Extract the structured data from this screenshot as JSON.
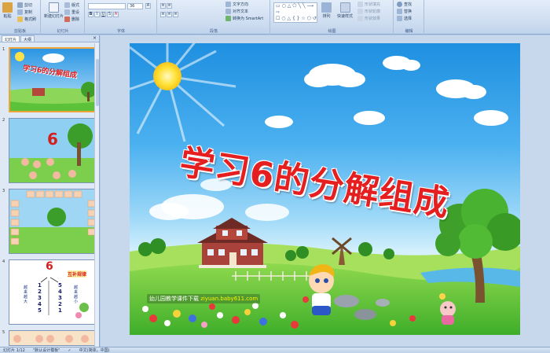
{
  "ribbon": {
    "clipboard": {
      "label": "剪贴板",
      "paste": "粘贴",
      "cut": "剪切",
      "copy": "复制",
      "format": "格式刷"
    },
    "slides": {
      "label": "幻灯片",
      "new_slide": "新建幻灯片",
      "layout": "版式",
      "reset": "重设",
      "delete": "删除"
    },
    "font": {
      "label": "字体",
      "font_name": "",
      "font_size": "36"
    },
    "paragraph": {
      "label": "段落",
      "text_direction": "文字方向",
      "align_text": "对齐文本",
      "smartart": "转换为 SmartArt"
    },
    "drawing": {
      "label": "绘图",
      "arrange": "排列",
      "quick_styles": "快速样式",
      "shape_fill": "形状填充",
      "shape_outline": "形状轮廓",
      "shape_effects": "形状效果"
    },
    "editing": {
      "label": "编辑",
      "find": "查找",
      "replace": "替换",
      "select": "选择"
    }
  },
  "left_pane": {
    "tabs": [
      "幻灯片",
      "大纲"
    ],
    "close": "×",
    "slides": [
      {
        "num": "1",
        "title": "学习6的分解组成"
      },
      {
        "num": "2",
        "title": "6"
      },
      {
        "num": "3",
        "title": ""
      },
      {
        "num": "4",
        "title": "6",
        "label": "互补规律",
        "left_col": [
          "1",
          "2",
          "3",
          "4",
          "5"
        ],
        "right_col": [
          "5",
          "4",
          "3",
          "2",
          "1"
        ],
        "side_left": "越来越大",
        "side_right": "越来越小"
      },
      {
        "num": "5",
        "title": ""
      }
    ]
  },
  "slide": {
    "title": "学习6的分解组成",
    "credit": "幼儿园教学课件下载",
    "url": "ziyuan.baby611.com"
  },
  "status": {
    "slide_info": "幻灯片 1/12",
    "theme": "\"默认设计模板\"",
    "language": "中文(简体，中国)"
  },
  "colors": {
    "accent": "#e51f1f",
    "ribbon": "#cddcf0",
    "selection": "#f0a53a"
  }
}
